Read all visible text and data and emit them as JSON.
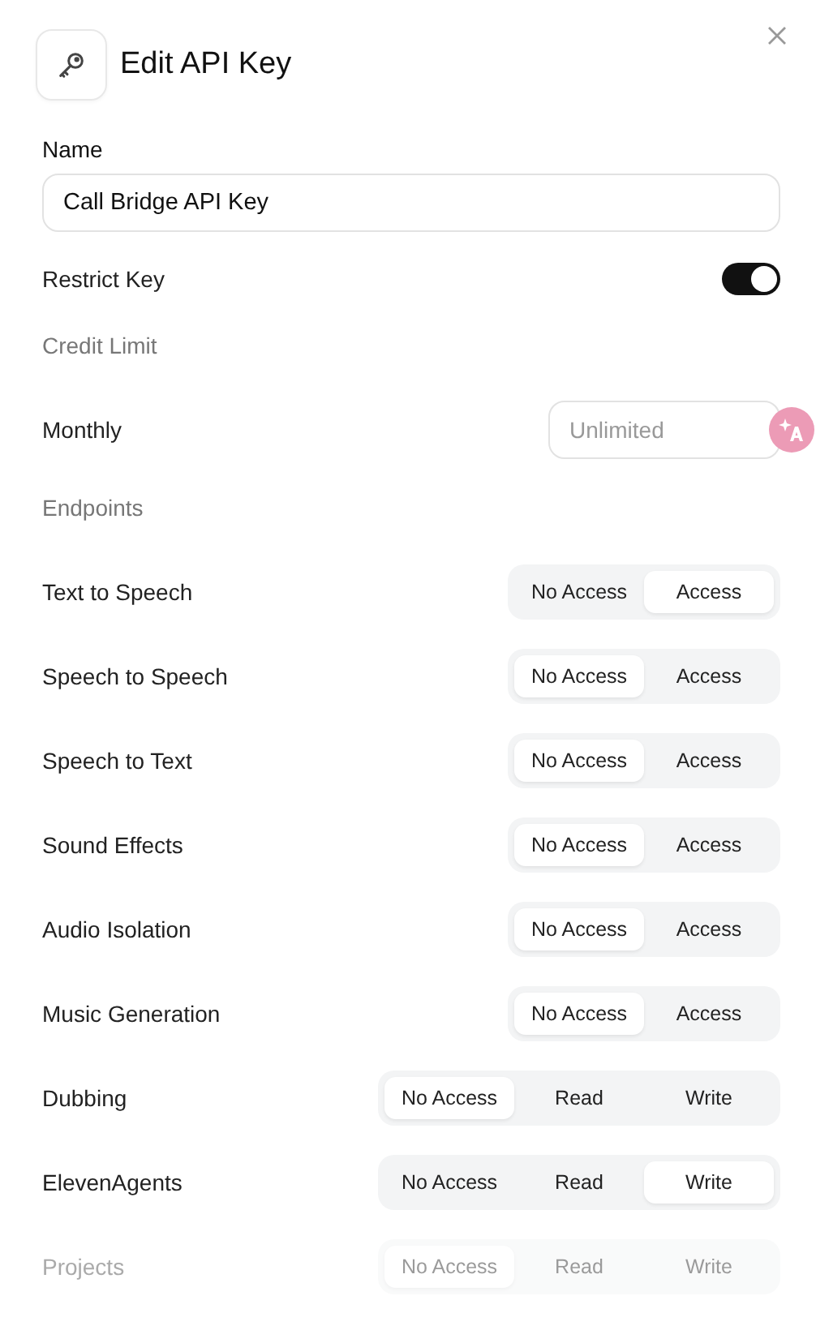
{
  "dialog": {
    "title": "Edit API Key"
  },
  "name_field": {
    "label": "Name",
    "value": "Call Bridge API Key"
  },
  "restrict_key": {
    "label": "Restrict Key",
    "on": true
  },
  "credit_limit": {
    "heading": "Credit Limit",
    "label": "Monthly",
    "placeholder": "Unlimited"
  },
  "endpoints": {
    "heading": "Endpoints",
    "rows": [
      {
        "label": "Text to Speech",
        "disabled": false,
        "options": [
          {
            "label": "No Access",
            "selected": false
          },
          {
            "label": "Access",
            "selected": true
          }
        ]
      },
      {
        "label": "Speech to Speech",
        "disabled": false,
        "options": [
          {
            "label": "No Access",
            "selected": true
          },
          {
            "label": "Access",
            "selected": false
          }
        ]
      },
      {
        "label": "Speech to Text",
        "disabled": false,
        "options": [
          {
            "label": "No Access",
            "selected": true
          },
          {
            "label": "Access",
            "selected": false
          }
        ]
      },
      {
        "label": "Sound Effects",
        "disabled": false,
        "options": [
          {
            "label": "No Access",
            "selected": true
          },
          {
            "label": "Access",
            "selected": false
          }
        ]
      },
      {
        "label": "Audio Isolation",
        "disabled": false,
        "options": [
          {
            "label": "No Access",
            "selected": true
          },
          {
            "label": "Access",
            "selected": false
          }
        ]
      },
      {
        "label": "Music Generation",
        "disabled": false,
        "options": [
          {
            "label": "No Access",
            "selected": true
          },
          {
            "label": "Access",
            "selected": false
          }
        ]
      },
      {
        "label": "Dubbing",
        "disabled": false,
        "options": [
          {
            "label": "No Access",
            "selected": true
          },
          {
            "label": "Read",
            "selected": false
          },
          {
            "label": "Write",
            "selected": false
          }
        ]
      },
      {
        "label": "ElevenAgents",
        "disabled": false,
        "options": [
          {
            "label": "No Access",
            "selected": false
          },
          {
            "label": "Read",
            "selected": false
          },
          {
            "label": "Write",
            "selected": true
          }
        ]
      },
      {
        "label": "Projects",
        "disabled": true,
        "options": [
          {
            "label": "No Access",
            "selected": true
          },
          {
            "label": "Read",
            "selected": false
          },
          {
            "label": "Write",
            "selected": false
          }
        ]
      }
    ]
  }
}
